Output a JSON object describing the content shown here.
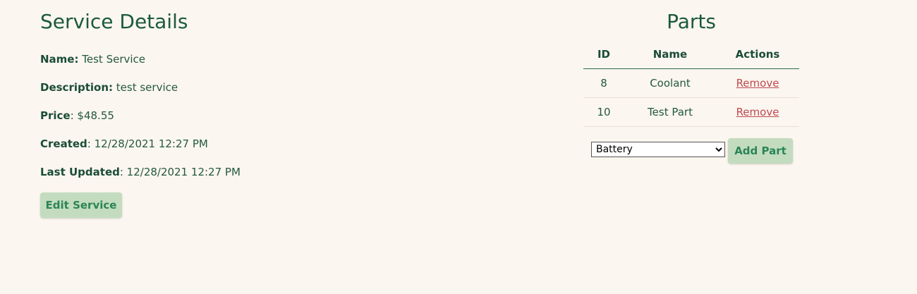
{
  "service": {
    "title": "Service Details",
    "name_label": "Name:",
    "name_value": "Test Service",
    "description_label": "Description:",
    "description_value": "test service",
    "price_label": "Price",
    "price_value": ": $48.55",
    "created_label": "Created",
    "created_value": ": 12/28/2021 12:27 PM",
    "updated_label": "Last Updated",
    "updated_value": ": 12/28/2021 12:27 PM",
    "edit_button": "Edit Service"
  },
  "parts": {
    "title": "Parts",
    "columns": [
      "ID",
      "Name",
      "Actions"
    ],
    "rows": [
      {
        "id": "8",
        "name": "Coolant",
        "action": "Remove"
      },
      {
        "id": "10",
        "name": "Test Part",
        "action": "Remove"
      }
    ],
    "select_value": "Battery",
    "add_button": "Add Part"
  },
  "colors": {
    "background": "#fbf6ef",
    "text": "#1f5a3e",
    "button_bg": "#c3dcbf",
    "button_text": "#2b8457",
    "link": "#c0474f"
  }
}
